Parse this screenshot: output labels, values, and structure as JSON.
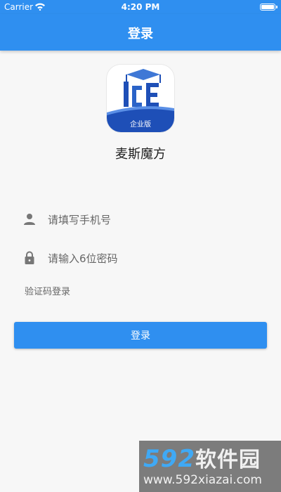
{
  "status_bar": {
    "carrier": "Carrier",
    "time": "4:20 PM"
  },
  "navbar": {
    "title": "登录"
  },
  "logo": {
    "badge_text": "企业版",
    "colors": {
      "primary": "#1e4fb7",
      "accent": "#2f8ff0"
    }
  },
  "app": {
    "name": "麦斯魔方"
  },
  "form": {
    "phone_placeholder": "请填写手机号",
    "password_placeholder": "请输入6位密码",
    "sms_login_link": "验证码登录",
    "login_button": "登录"
  },
  "watermark": {
    "brand_num": "592",
    "brand_cn": "软件园",
    "url": "www.592xiazai.com"
  },
  "icons": [
    "wifi-icon",
    "battery-icon",
    "user-icon",
    "lock-icon"
  ],
  "colors": {
    "accent": "#2f8ff0",
    "background": "#f7f7f7",
    "text": "#222222",
    "muted": "#666666"
  }
}
